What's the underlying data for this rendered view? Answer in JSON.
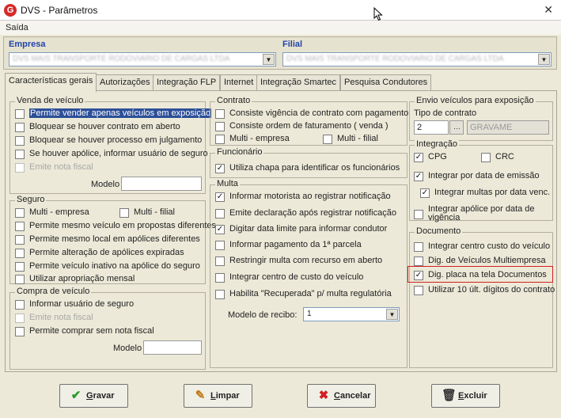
{
  "window": {
    "title": "DVS - Parâmetros",
    "close_glyph": "✕"
  },
  "menu": {
    "items": [
      "Saída"
    ]
  },
  "header": {
    "empresa_label": "Empresa",
    "empresa_value": "DVS MAIS TRANSPORTE RODOVIARIO DE CARGAS LTDA",
    "filial_label": "Filial",
    "filial_value": "DVS MAIS TRANSPORTE RODOVIARIO DE CARGAS LTDA"
  },
  "tabs": [
    "Características gerais",
    "Autorizações",
    "Integração FLP",
    "Internet",
    "Integração Smartec",
    "Pesquisa Condutores"
  ],
  "venda": {
    "title": "Venda de veículo",
    "items": [
      {
        "label": "Permite vender apenas veículos em exposição",
        "checked": false,
        "highlight": true
      },
      {
        "label": "Bloquear se houver contrato em aberto",
        "checked": false
      },
      {
        "label": "Bloquear se houver processo em julgamento",
        "checked": false
      },
      {
        "label": "Se houver apólice, informar usuário de seguro",
        "checked": false
      },
      {
        "label": "Emite nota fiscal",
        "checked": false,
        "disabled": true
      }
    ],
    "modelo_label": "Modelo"
  },
  "seguro": {
    "title": "Seguro",
    "multi_empresa": "Multi - empresa",
    "multi_filial": "Multi - filial",
    "items": [
      {
        "label": "Permite mesmo veículo em propostas diferentes",
        "checked": false
      },
      {
        "label": "Permite mesmo local em apólices diferentes",
        "checked": false
      },
      {
        "label": "Permite alteração de apólices expiradas",
        "checked": false
      },
      {
        "label": "Permite veículo inativo na apólice do seguro",
        "checked": false
      },
      {
        "label": "Utilizar apropriação mensal",
        "checked": false
      }
    ]
  },
  "compra": {
    "title": "Compra de veículo",
    "items": [
      {
        "label": "Informar usuário de seguro",
        "checked": false
      },
      {
        "label": "Emite nota fiscal",
        "checked": false,
        "disabled": true
      },
      {
        "label": "Permite comprar sem nota fiscal",
        "checked": false
      }
    ],
    "modelo_label": "Modelo"
  },
  "contrato": {
    "title": "Contrato",
    "items": [
      {
        "label": "Consiste vigência de contrato com pagamento",
        "checked": false
      },
      {
        "label": "Consiste ordem de faturamento ( venda )",
        "checked": false
      }
    ],
    "multi_empresa": "Multi - empresa",
    "multi_filial": "Multi - filial"
  },
  "funcionario": {
    "title": "Funcionário",
    "items": [
      {
        "label": "Utiliza chapa para identificar os funcionários",
        "checked": true
      }
    ]
  },
  "multa": {
    "title": "Multa",
    "items": [
      {
        "label": "Informar motorista ao registrar notificação",
        "checked": true
      },
      {
        "label": "Emite declaração após registrar notificação",
        "checked": false
      },
      {
        "label": "Digitar data limite para informar condutor",
        "checked": true
      },
      {
        "label": "Informar pagamento da 1ª parcela",
        "checked": false
      },
      {
        "label": "Restringir multa com recurso em aberto",
        "checked": false
      },
      {
        "label": "Integrar centro de custo do veículo",
        "checked": false
      },
      {
        "label": "Habilita \"Recuperada\" p/ multa regulatória",
        "checked": false
      }
    ],
    "modelo_recibo_label": "Modelo de recibo:",
    "modelo_recibo_value": "1"
  },
  "envio": {
    "title": "Envio veículos para exposição",
    "tipo_label": "Tipo de contrato",
    "tipo_value": "2",
    "tipo_desc": "GRAVAME"
  },
  "integracao": {
    "title": "Integração",
    "cpg": {
      "label": "CPG",
      "checked": true
    },
    "crc": {
      "label": "CRC",
      "checked": false
    },
    "items": [
      {
        "label": "Integrar por data de emissão",
        "checked": true
      },
      {
        "label": "Integrar multas por data venc.",
        "checked": true
      },
      {
        "label": "Integrar apólice por data de vigência",
        "checked": false
      }
    ]
  },
  "documento": {
    "title": "Documento",
    "items": [
      {
        "label": "Integrar centro custo do veículo",
        "checked": false
      },
      {
        "label": "Dig. de Veículos Multiempresa",
        "checked": false
      },
      {
        "label": "Dig. placa na tela Documentos",
        "checked": true
      },
      {
        "label": "Utilizar 10 últ. dígitos do contrato",
        "checked": false
      }
    ]
  },
  "buttons": {
    "gravar": "Gravar",
    "limpar": "Limpar",
    "cancelar": "Cancelar",
    "excluir": "Excluir"
  },
  "colors": {
    "accent": "#2244aa",
    "highlight_selection": "#2d4f98",
    "annotation_red": "#d02020"
  }
}
